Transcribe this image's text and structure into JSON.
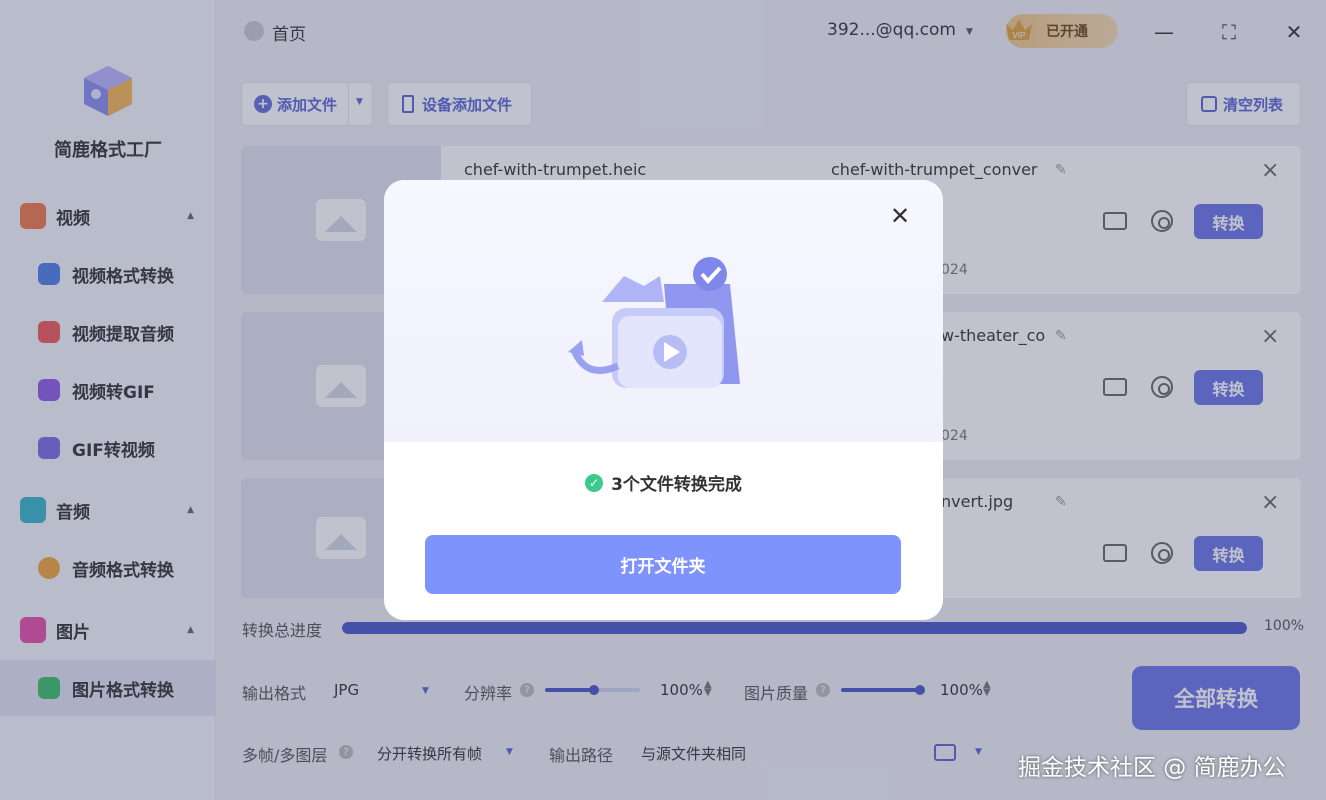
{
  "app": {
    "name": "简鹿格式工厂"
  },
  "header": {
    "home_label": "首页",
    "account": "392...@qq.com",
    "vip_label": "已开通",
    "vip_badge": "VIP"
  },
  "sidebar": {
    "groups": [
      {
        "label": "视频",
        "items": [
          {
            "label": "视频格式转换"
          },
          {
            "label": "视频提取音频"
          },
          {
            "label": "视频转GIF"
          },
          {
            "label": "GIF转视频"
          }
        ]
      },
      {
        "label": "音频",
        "items": [
          {
            "label": "音频格式转换"
          }
        ]
      },
      {
        "label": "图片",
        "items": [
          {
            "label": "图片格式转换"
          }
        ]
      }
    ],
    "active_item": "图片格式转换"
  },
  "toolbar": {
    "add_file": "添加文件",
    "device_add": "设备添加文件",
    "clear_list": "清空列表"
  },
  "files": [
    {
      "source": "chef-with-trumpet.heic",
      "output": "chef-with-trumpet_conver",
      "date_fragment": "024",
      "convert_label": "转换"
    },
    {
      "source": "",
      "output": "w-theater_co",
      "date_fragment": "024",
      "convert_label": "转换"
    },
    {
      "source": "",
      "output": "nvert.jpg",
      "date_fragment": "",
      "convert_label": "转换"
    }
  ],
  "progress": {
    "label": "转换总进度",
    "value": 100,
    "text": "100%"
  },
  "settings": {
    "output_format_label": "输出格式",
    "output_format_value": "JPG",
    "resolution_label": "分辨率",
    "resolution_value": "100%",
    "quality_label": "图片质量",
    "quality_value": "100%",
    "multiframe_label": "多帧/多图层",
    "multiframe_value": "分开转换所有帧",
    "output_path_label": "输出路径",
    "output_path_value": "与源文件夹相同",
    "convert_all": "全部转换"
  },
  "modal": {
    "status_text": "3个文件转换完成",
    "open_folder": "打开文件夹"
  },
  "watermark": "掘金技术社区 @ 简鹿办公",
  "colors": {
    "accent": "#6c77e8",
    "progress": "#4a57c9",
    "modal_button": "#7e93fb",
    "success": "#3cc98c"
  }
}
